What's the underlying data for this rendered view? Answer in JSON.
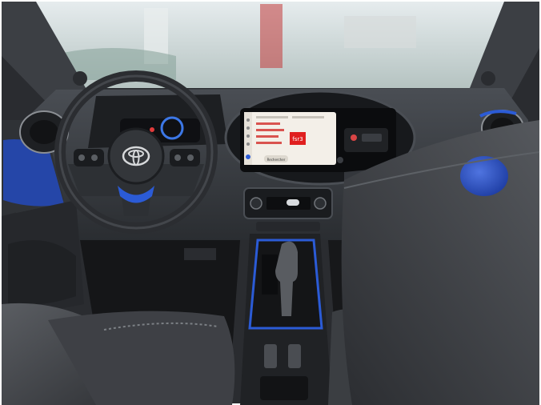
{
  "scene": {
    "subject": "car-interior-dashboard",
    "brand_logo": "toyota-logo",
    "colors": {
      "frame": "#d9d9d9",
      "windshield_bg": "#c9d3d6",
      "dash": "#3a3d42",
      "dash_dark": "#24272b",
      "blue_trim": "#2546a8",
      "seat": "#4b4d52",
      "seat_light": "#6f7378",
      "screen_bg": "#f3efe8",
      "screen_accent": "#e01f1f"
    }
  },
  "infotainment": {
    "logo_text": "fsr3",
    "button_label": "Rechercher"
  }
}
